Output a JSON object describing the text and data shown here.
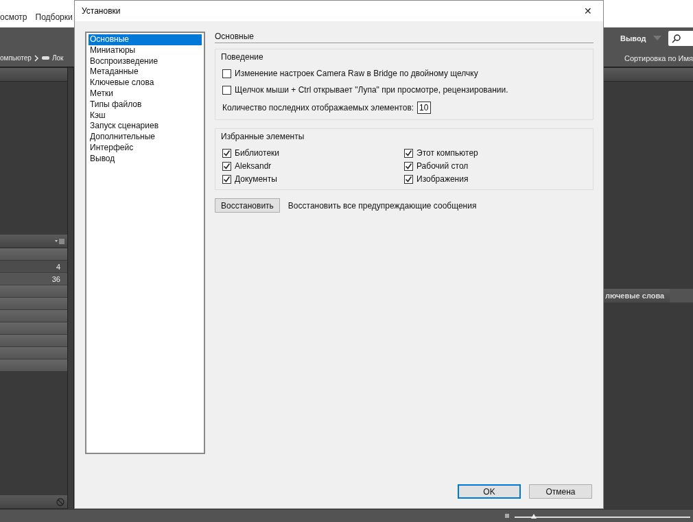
{
  "app": {
    "menu": [
      "осмотр",
      "Подборки"
    ],
    "workspace": "Вывод",
    "path": [
      "омпьютер",
      "Лок"
    ],
    "sort": "Сортировка по Имя",
    "filter_rows": [
      "4",
      "36"
    ],
    "right_tab": "лючевые слова",
    "zoom": {
      "level": 0.1
    }
  },
  "dialog": {
    "title": "Установки",
    "close": "✕",
    "categories": [
      {
        "label": "Основные",
        "selected": true
      },
      {
        "label": "Миниатюры",
        "selected": false
      },
      {
        "label": "Воспроизведение",
        "selected": false
      },
      {
        "label": "Метаданные",
        "selected": false
      },
      {
        "label": "Ключевые слова",
        "selected": false
      },
      {
        "label": "Метки",
        "selected": false
      },
      {
        "label": "Типы файлов",
        "selected": false
      },
      {
        "label": "Кэш",
        "selected": false
      },
      {
        "label": "Запуск сценариев",
        "selected": false
      },
      {
        "label": "Дополнительные",
        "selected": false
      },
      {
        "label": "Интерфейс",
        "selected": false
      },
      {
        "label": "Вывод",
        "selected": false
      }
    ],
    "section": "Основные",
    "behavior": {
      "title": "Поведение",
      "options": [
        {
          "label": "Изменение настроек Camera Raw в Bridge по двойному щелчку",
          "checked": false
        },
        {
          "label": "Щелчок мыши + Ctrl открывает \"Лупа\" при просмотре, рецензировании.",
          "checked": false
        }
      ],
      "recent_label": "Количество последних отображаемых элементов:",
      "recent_value": "10"
    },
    "favorites": {
      "title": "Избранные элементы",
      "items": [
        {
          "label": "Библиотеки",
          "checked": true
        },
        {
          "label": "Этот компьютер",
          "checked": true
        },
        {
          "label": "Aleksandr",
          "checked": true
        },
        {
          "label": "Рабочий стол",
          "checked": true
        },
        {
          "label": "Документы",
          "checked": true
        },
        {
          "label": "Изображения",
          "checked": true
        }
      ]
    },
    "reset_button": "Восстановить",
    "reset_text": "Восстановить все предупреждающие сообщения",
    "buttons": [
      {
        "label": "OK",
        "default": true
      },
      {
        "label": "Отмена",
        "default": false
      }
    ]
  }
}
